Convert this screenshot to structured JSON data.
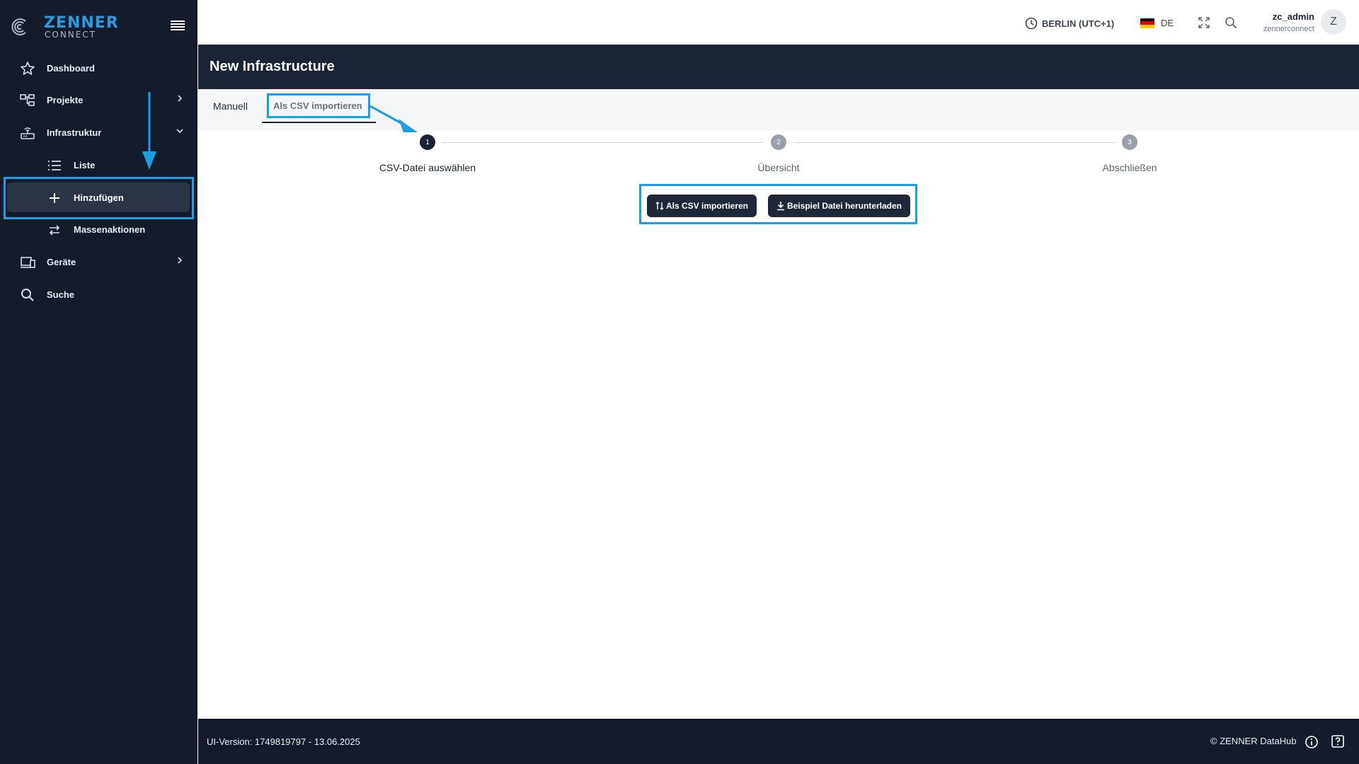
{
  "brand": {
    "name": "ZENNER",
    "sub": "CONNECT",
    "accent_color": "#1aa0e2",
    "sidebar_color": "#141c2c"
  },
  "sidebar": {
    "items": [
      {
        "label": "Dashboard",
        "icon": "star-icon"
      },
      {
        "label": "Projekte",
        "icon": "hierarchy-icon"
      },
      {
        "label": "Infrastruktur",
        "icon": "router-icon"
      },
      {
        "label": "Liste",
        "icon": "list-icon"
      },
      {
        "label": "Hinzufügen",
        "icon": "plus-icon"
      },
      {
        "label": "Massenaktionen",
        "icon": "swap-arrows-icon"
      },
      {
        "label": "Geräte",
        "icon": "devices-icon"
      },
      {
        "label": "Suche",
        "icon": "search-icon"
      }
    ]
  },
  "topbar": {
    "timezone": "BERLIN (UTC+1)",
    "language": "DE",
    "user_name": "zc_admin",
    "user_org": "zennerconnect",
    "avatar_initial": "Z"
  },
  "page": {
    "title": "New Infrastructure"
  },
  "tabs": [
    {
      "label": "Manuell"
    },
    {
      "label": "Als CSV importieren"
    }
  ],
  "stepper": {
    "steps": [
      {
        "number": "1",
        "label": "CSV-Datei auswählen"
      },
      {
        "number": "2",
        "label": "Übersicht"
      },
      {
        "number": "3",
        "label": "Abschließen"
      }
    ]
  },
  "actions": {
    "import_label": "Als CSV importieren",
    "download_label": "Beispiel Datei herunterladen"
  },
  "footer": {
    "version": "UI-Version: 1749819797 - 13.06.2025",
    "copyright": "© ZENNER DataHub"
  }
}
